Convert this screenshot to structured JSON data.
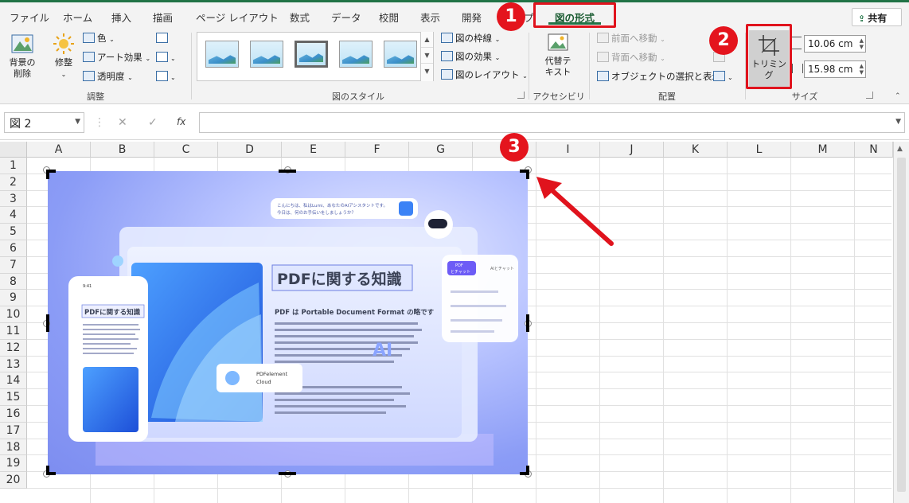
{
  "ribbon_tabs": [
    "ファイル",
    "ホーム",
    "挿入",
    "描画",
    "ページ レイアウト",
    "数式",
    "データ",
    "校閲",
    "表示",
    "開発",
    "プ"
  ],
  "active_tab": "図の形式",
  "share_label": "共有",
  "adjust": {
    "remove_bg_line1": "背景の",
    "remove_bg_line2": "削除",
    "corrections": "修整",
    "color": "色",
    "artistic": "アート効果",
    "transparency": "透明度",
    "group_label": "調整"
  },
  "picture_styles": {
    "border": "図の枠線",
    "effects": "図の効果",
    "layout": "図のレイアウト",
    "group_label": "図のスタイル"
  },
  "accessibility": {
    "alt_text_line1": "代替テ",
    "alt_text_line2": "キスト",
    "group_label": "アクセシビリティ"
  },
  "arrange": {
    "bring_forward": "前面へ移動",
    "send_backward": "背面へ移動",
    "selection_pane": "オブジェクトの選択と表示",
    "group_label": "配置"
  },
  "size": {
    "crop": "トリミング",
    "height": "10.06 cm",
    "width": "15.98 cm",
    "group_label": "サイズ"
  },
  "formula_bar": {
    "name_box": "図 2",
    "fx_label": "fx",
    "cancel_symbol": "✕",
    "confirm_symbol": "✓",
    "formula_value": ""
  },
  "columns": [
    "A",
    "B",
    "C",
    "D",
    "E",
    "F",
    "G",
    "H",
    "I",
    "J",
    "K",
    "L",
    "M",
    "N"
  ],
  "rows": [
    "1",
    "2",
    "3",
    "4",
    "5",
    "6",
    "7",
    "8",
    "9",
    "10",
    "11",
    "12",
    "13",
    "14",
    "15",
    "16",
    "17",
    "18",
    "19",
    "20"
  ],
  "badges": [
    "1",
    "2",
    "3"
  ],
  "picture": {
    "chat_line1": "こんにちは、私はLumi、あなたのAIアシスタントです。",
    "chat_line2": "今日は、何のお手伝いをしましょうか？",
    "main_title": "PDFに関する知識",
    "subtitle": "PDF は Portable Document Format の略です",
    "phone_title": "PDFに関する知識",
    "phone_time": "9:41",
    "cloud_label_line1": "PDFelement",
    "cloud_label_line2": "Cloud",
    "ai_label": "AI",
    "panel_button_line1": "PDF",
    "panel_button_line2": "とチャット",
    "panel_header_right": "AIとチャット"
  },
  "colors": {
    "accent": "#217346",
    "badge_red": "#e4141d",
    "picture_blue": "#8b9cf6"
  }
}
